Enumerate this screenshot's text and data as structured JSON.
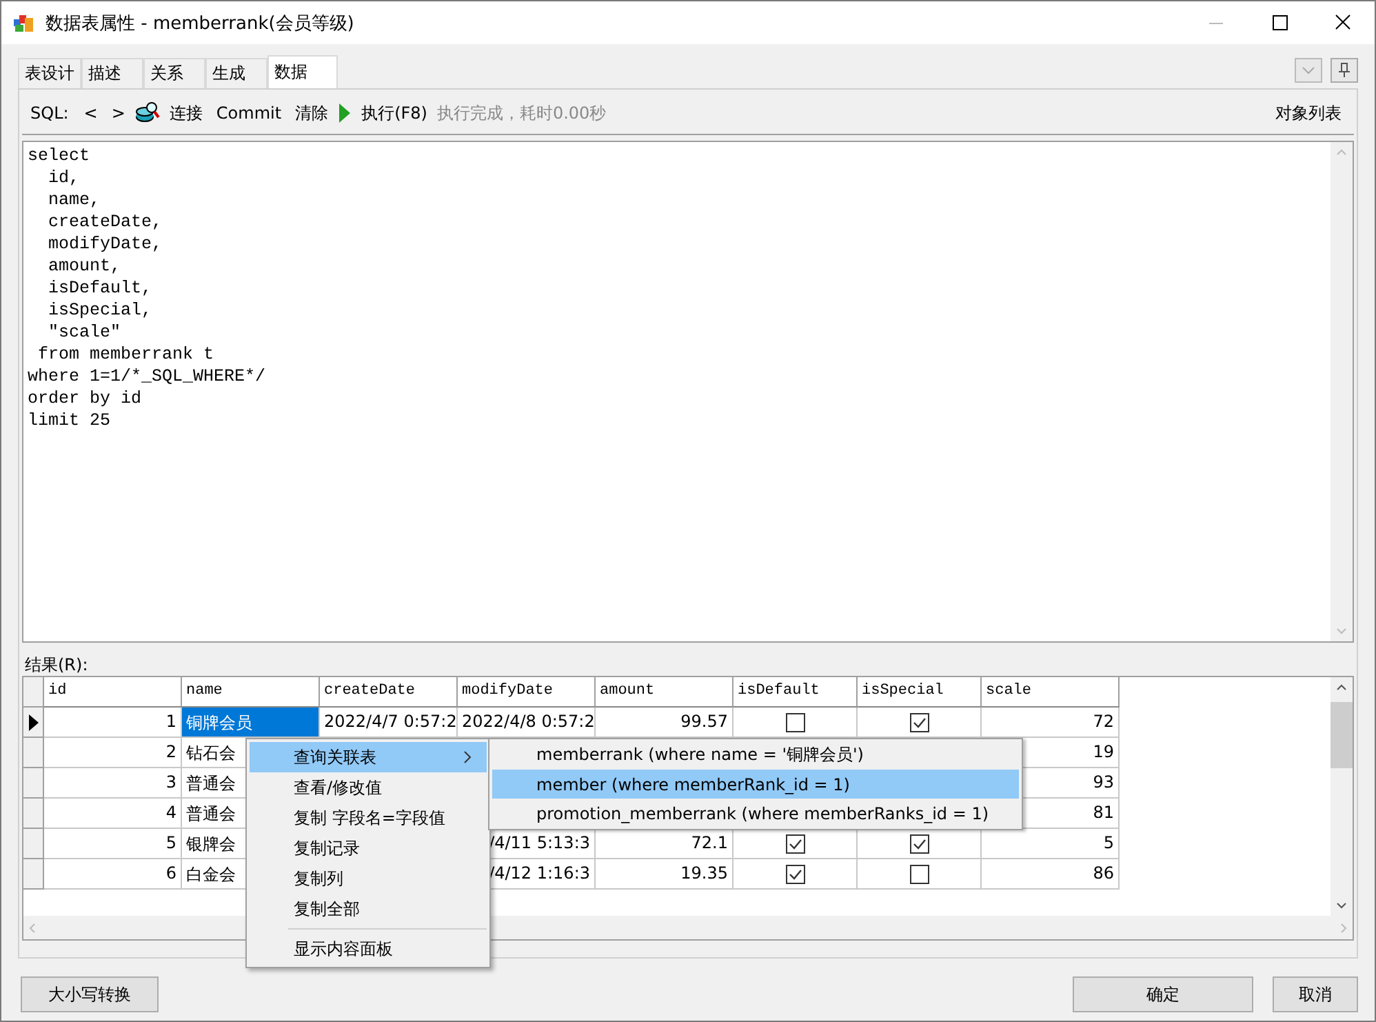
{
  "window": {
    "title": "数据表属性 - memberrank(会员等级)"
  },
  "tabs": [
    {
      "label": "表设计",
      "selected": false
    },
    {
      "label": "描述",
      "selected": false
    },
    {
      "label": "关系",
      "selected": false
    },
    {
      "label": "生成",
      "selected": false
    },
    {
      "label": "数据",
      "selected": true
    }
  ],
  "toolbar": {
    "sql_label": "SQL:",
    "prev": "<",
    "next": ">",
    "connect": "连接",
    "commit": "Commit",
    "clear": "清除",
    "execute": "执行(F8)",
    "status": "执行完成，耗时0.00秒",
    "object_list": "对象列表"
  },
  "editor": {
    "lines": [
      "select",
      "  id,",
      "  name,",
      "  createDate,",
      "  modifyDate,",
      "  amount,",
      "  isDefault,",
      "  isSpecial,",
      "  \"scale\"",
      " from memberrank t",
      "where 1=1/*_SQL_WHERE*/",
      "order by id",
      "limit 25"
    ]
  },
  "results": {
    "label": "结果(R):",
    "columns": [
      "id",
      "name",
      "createDate",
      "modifyDate",
      "amount",
      "isDefault",
      "isSpecial",
      "scale"
    ],
    "rows": [
      {
        "selected": true,
        "cells": [
          {
            "kind": "text",
            "text": "1",
            "selected": false
          },
          {
            "kind": "text",
            "text": "铜牌会员",
            "selected": true
          },
          {
            "kind": "text",
            "text": "2022/4/7 0:57:2",
            "selected": false
          },
          {
            "kind": "text",
            "text": "2022/4/8 0:57:2",
            "selected": false
          },
          {
            "kind": "text",
            "text": "99.57",
            "selected": false
          },
          {
            "kind": "checkbox",
            "checked": false
          },
          {
            "kind": "checkbox",
            "checked": true
          },
          {
            "kind": "text",
            "text": "72",
            "selected": false
          }
        ]
      },
      {
        "selected": false,
        "cells": [
          {
            "kind": "text",
            "text": "2",
            "selected": false
          },
          {
            "kind": "text",
            "text": "钻石会",
            "selected": false
          },
          {
            "kind": "blank"
          },
          {
            "kind": "blank"
          },
          {
            "kind": "blank"
          },
          {
            "kind": "blank"
          },
          {
            "kind": "blank"
          },
          {
            "kind": "text",
            "text": "19",
            "selected": false
          }
        ]
      },
      {
        "selected": false,
        "cells": [
          {
            "kind": "text",
            "text": "3",
            "selected": false
          },
          {
            "kind": "text",
            "text": "普通会",
            "selected": false
          },
          {
            "kind": "blank"
          },
          {
            "kind": "blank"
          },
          {
            "kind": "blank"
          },
          {
            "kind": "blank"
          },
          {
            "kind": "blank"
          },
          {
            "kind": "text",
            "text": "93",
            "selected": false
          }
        ]
      },
      {
        "selected": false,
        "cells": [
          {
            "kind": "text",
            "text": "4",
            "selected": false
          },
          {
            "kind": "text",
            "text": "普通会",
            "selected": false
          },
          {
            "kind": "blank"
          },
          {
            "kind": "blank"
          },
          {
            "kind": "blank"
          },
          {
            "kind": "blank"
          },
          {
            "kind": "blank"
          },
          {
            "kind": "text",
            "text": "81",
            "selected": false
          }
        ]
      },
      {
        "selected": false,
        "cells": [
          {
            "kind": "text",
            "text": "5",
            "selected": false
          },
          {
            "kind": "text",
            "text": "银牌会",
            "selected": false
          },
          {
            "kind": "blank"
          },
          {
            "kind": "text",
            "text": "/4/11 5:13:3",
            "selected": false
          },
          {
            "kind": "text",
            "text": "72.1",
            "selected": false
          },
          {
            "kind": "checkbox",
            "checked": true
          },
          {
            "kind": "checkbox",
            "checked": true
          },
          {
            "kind": "text",
            "text": "5",
            "selected": false
          }
        ]
      },
      {
        "selected": false,
        "cells": [
          {
            "kind": "text",
            "text": "6",
            "selected": false
          },
          {
            "kind": "text",
            "text": "白金会",
            "selected": false
          },
          {
            "kind": "blank"
          },
          {
            "kind": "text",
            "text": "/4/12 1:16:3",
            "selected": false
          },
          {
            "kind": "text",
            "text": "19.35",
            "selected": false
          },
          {
            "kind": "checkbox",
            "checked": true
          },
          {
            "kind": "checkbox",
            "checked": false
          },
          {
            "kind": "text",
            "text": "86",
            "selected": false
          }
        ]
      }
    ]
  },
  "context_menu": {
    "items": [
      {
        "kind": "item",
        "label": "查询关联表",
        "has_submenu": true,
        "selected": true
      },
      {
        "kind": "item",
        "label": "查看/修改值",
        "has_submenu": false,
        "selected": false
      },
      {
        "kind": "item",
        "label": "复制 字段名=字段值",
        "has_submenu": false,
        "selected": false
      },
      {
        "kind": "item",
        "label": "复制记录",
        "has_submenu": false,
        "selected": false
      },
      {
        "kind": "item",
        "label": "复制列",
        "has_submenu": false,
        "selected": false
      },
      {
        "kind": "item",
        "label": "复制全部",
        "has_submenu": false,
        "selected": false
      },
      {
        "kind": "separator"
      },
      {
        "kind": "item",
        "label": "显示内容面板",
        "has_submenu": false,
        "selected": false
      }
    ]
  },
  "submenu": {
    "items": [
      {
        "label": "memberrank (where name = '铜牌会员')",
        "selected": false
      },
      {
        "label": "member (where memberRank_id = 1)",
        "selected": true
      },
      {
        "label": "promotion_memberrank (where memberRanks_id = 1)",
        "selected": false
      }
    ]
  },
  "buttons": {
    "left": "大小写转换",
    "ok": "确定",
    "cancel": "取消"
  }
}
